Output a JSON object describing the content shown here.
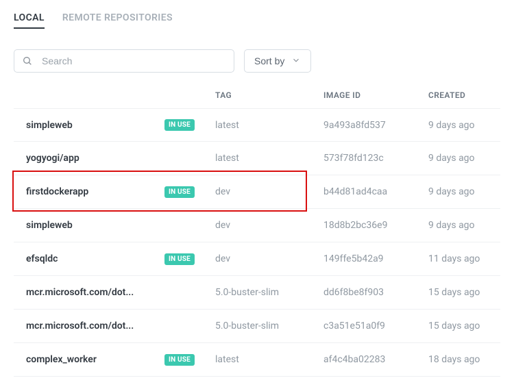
{
  "tabs": {
    "local": "LOCAL",
    "remote": "REMOTE REPOSITORIES"
  },
  "search": {
    "placeholder": "Search"
  },
  "sort": {
    "label": "Sort by"
  },
  "headers": {
    "tag": "TAG",
    "image_id": "IMAGE ID",
    "created": "CREATED"
  },
  "badge_label": "IN USE",
  "rows": [
    {
      "name": "simpleweb",
      "in_use": true,
      "tag": "latest",
      "image_id": "9a493a8fd537",
      "created": "9 days ago",
      "highlight": false
    },
    {
      "name": "yogyogi/app",
      "in_use": false,
      "tag": "latest",
      "image_id": "573f78fd123c",
      "created": "9 days ago",
      "highlight": false
    },
    {
      "name": "firstdockerapp",
      "in_use": true,
      "tag": "dev",
      "image_id": "b44d81ad4caa",
      "created": "9 days ago",
      "highlight": true
    },
    {
      "name": "simpleweb",
      "in_use": false,
      "tag": "dev",
      "image_id": "18d8b2bc36e9",
      "created": "9 days ago",
      "highlight": false
    },
    {
      "name": "efsqldc",
      "in_use": true,
      "tag": "dev",
      "image_id": "149ffe5b42a9",
      "created": "11 days ago",
      "highlight": false
    },
    {
      "name": "mcr.microsoft.com/dot...",
      "in_use": false,
      "tag": "5.0-buster-slim",
      "image_id": "dd6f8be8f903",
      "created": "15 days ago",
      "highlight": false
    },
    {
      "name": "mcr.microsoft.com/dot...",
      "in_use": false,
      "tag": "5.0-buster-slim",
      "image_id": "c3a51e51a0f9",
      "created": "15 days ago",
      "highlight": false
    },
    {
      "name": "complex_worker",
      "in_use": true,
      "tag": "latest",
      "image_id": "af4c4ba02283",
      "created": "18 days ago",
      "highlight": false
    }
  ]
}
